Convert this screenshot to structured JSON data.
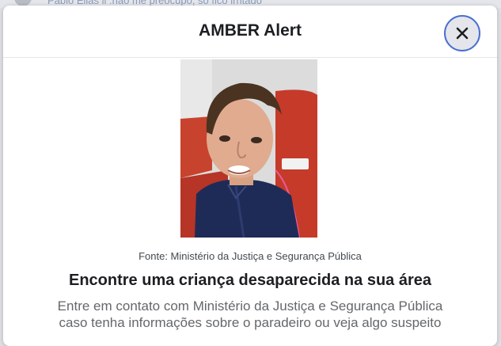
{
  "background": {
    "comment_text": "Pablo Elias ll :não me preocupo, só fico irritado"
  },
  "modal": {
    "title": "AMBER Alert",
    "close_icon": "close-icon",
    "photo_description_icon": "child-photo",
    "source_caption": "Fonte: Ministério da Justiça e Segurança Pública",
    "headline": "Encontre uma criança desaparecida na sua área",
    "description_line1": "Entre em contato com Ministério da Justiça e Segurança Pública",
    "description_line2": "caso tenha informações sobre o paradeiro ou veja algo suspeito"
  },
  "colors": {
    "close_button_ring": "#4a6fd1",
    "header_divider": "#e4e6eb"
  }
}
